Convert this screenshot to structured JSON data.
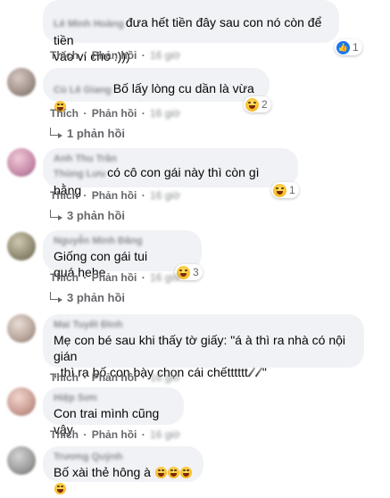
{
  "labels": {
    "like": "Thích",
    "reply": "Phản hồi",
    "separator": "·"
  },
  "comments": [
    {
      "author": "Lê Minh Hoàng",
      "text_line1": "đưa hết tiền đây sau con nó còn để tiền",
      "text_line2": "vào ví cho :)))",
      "time": "16 giờ",
      "reaction_count": "1"
    },
    {
      "author": "Cù Lê Giang",
      "text": "Bố lấy lòng cu dần là vừa",
      "time": "16 giờ",
      "reaction_count": "2",
      "replies": "1 phản hồi"
    },
    {
      "author": "Anh Thu Trần",
      "author2": "Thùng Lưu",
      "text": "có cô con gái này thì còn gì bằng",
      "time": "16 giờ",
      "reaction_count": "1",
      "replies": "3 phản hồi"
    },
    {
      "author": "Nguyễn Minh Đăng",
      "text": "Giống con gái tui quá.hehe",
      "time": "16 giờ",
      "reaction_count": "3",
      "replies": "3 phản hồi"
    },
    {
      "author": "Mai Tuyết Đình",
      "text_line1": "Mẹ con bé sau khi thấy tờ giấy: \"á à thì ra nhà có nội gián",
      "text_line2": ", thì ra bố con bày chọn cái chếtttttt",
      "text_line2_end": "\"",
      "time": "16 giờ"
    },
    {
      "author": "Hiệp Sơn",
      "text": "Con trai mình cũng vậy",
      "time": "16 giờ"
    },
    {
      "author": "Trương Quỳnh",
      "text": "Bố xài thẻ hông à"
    }
  ]
}
